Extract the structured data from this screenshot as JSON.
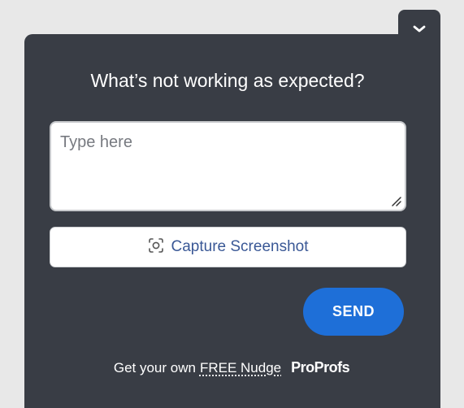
{
  "widget": {
    "title": "What’s not working as expected?",
    "input": {
      "placeholder": "Type here",
      "value": ""
    },
    "capture_label": "Capture Screenshot",
    "send_label": "SEND",
    "footer": {
      "prefix": "Get your own",
      "link": "FREE Nudge",
      "brand": "ProProfs"
    }
  },
  "colors": {
    "panel_bg": "#393d45",
    "page_bg": "#e8e8e8",
    "accent": "#1e6fd8",
    "capture_text": "#3a5896"
  },
  "icons": {
    "collapse": "chevron-down-icon",
    "capture": "camera-focus-icon",
    "resize": "resize-handle-icon"
  }
}
